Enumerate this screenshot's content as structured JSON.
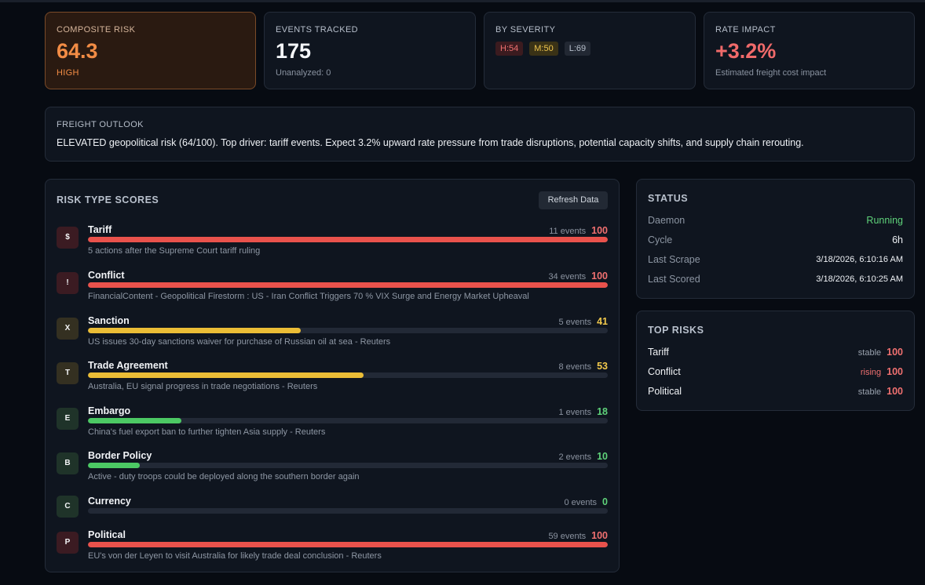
{
  "colors": {
    "high": "#e9524c",
    "medium": "#ebbd36",
    "low": "#4cc964",
    "high_text": "#f07070",
    "medium_text": "#f2c94c",
    "low_text": "#5fd27a",
    "running": "#5fd27a",
    "rising": "#f07070"
  },
  "composite": {
    "label": "COMPOSITE RISK",
    "value": "64.3",
    "level": "HIGH"
  },
  "events": {
    "label": "EVENTS TRACKED",
    "value": "175",
    "sub": "Unanalyzed: 0"
  },
  "severity": {
    "label": "BY SEVERITY",
    "high": "H:54",
    "medium": "M:50",
    "low": "L:69"
  },
  "rate": {
    "label": "RATE IMPACT",
    "value": "+3.2%",
    "sub": "Estimated freight cost impact"
  },
  "outlook": {
    "label": "FREIGHT OUTLOOK",
    "text": "ELEVATED geopolitical risk (64/100). Top driver: tariff events. Expect 3.2% upward rate pressure from trade disruptions, potential capacity shifts, and supply chain rerouting."
  },
  "risk_panel": {
    "title": "RISK TYPE SCORES",
    "refresh_label": "Refresh Data",
    "items": [
      {
        "icon": "$",
        "name": "Tariff",
        "events": "11 events",
        "score": 100,
        "level": "high",
        "desc": "5 actions after the Supreme Court tariff ruling"
      },
      {
        "icon": "!",
        "name": "Conflict",
        "events": "34 events",
        "score": 100,
        "level": "high",
        "desc": "FinancialContent - Geopolitical Firestorm : US - Iran Conflict Triggers 70 % VIX Surge and Energy Market Upheaval"
      },
      {
        "icon": "X",
        "name": "Sanction",
        "events": "5 events",
        "score": 41,
        "level": "medium",
        "desc": "US issues 30-day sanctions waiver for purchase of Russian oil at sea - Reuters"
      },
      {
        "icon": "T",
        "name": "Trade Agreement",
        "events": "8 events",
        "score": 53,
        "level": "medium",
        "desc": "Australia, EU signal progress in trade negotiations - Reuters"
      },
      {
        "icon": "E",
        "name": "Embargo",
        "events": "1 events",
        "score": 18,
        "level": "low",
        "desc": "China's fuel export ban to further tighten Asia supply - Reuters"
      },
      {
        "icon": "B",
        "name": "Border Policy",
        "events": "2 events",
        "score": 10,
        "level": "low",
        "desc": "Active - duty troops could be deployed along the southern border again"
      },
      {
        "icon": "C",
        "name": "Currency",
        "events": "0 events",
        "score": 0,
        "level": "low",
        "desc": ""
      },
      {
        "icon": "P",
        "name": "Political",
        "events": "59 events",
        "score": 100,
        "level": "high",
        "desc": "EU's von der Leyen to visit Australia for likely trade deal conclusion - Reuters"
      }
    ]
  },
  "status": {
    "title": "STATUS",
    "rows": [
      {
        "key": "Daemon",
        "value": "Running"
      },
      {
        "key": "Cycle",
        "value": "6h"
      },
      {
        "key": "Last Scrape",
        "value": "3/18/2026, 6:10:16 AM"
      },
      {
        "key": "Last Scored",
        "value": "3/18/2026, 6:10:25 AM"
      }
    ]
  },
  "top_risks": {
    "title": "TOP RISKS",
    "items": [
      {
        "name": "Tariff",
        "trend": "stable",
        "score": "100"
      },
      {
        "name": "Conflict",
        "trend": "rising",
        "score": "100"
      },
      {
        "name": "Political",
        "trend": "stable",
        "score": "100"
      }
    ]
  }
}
